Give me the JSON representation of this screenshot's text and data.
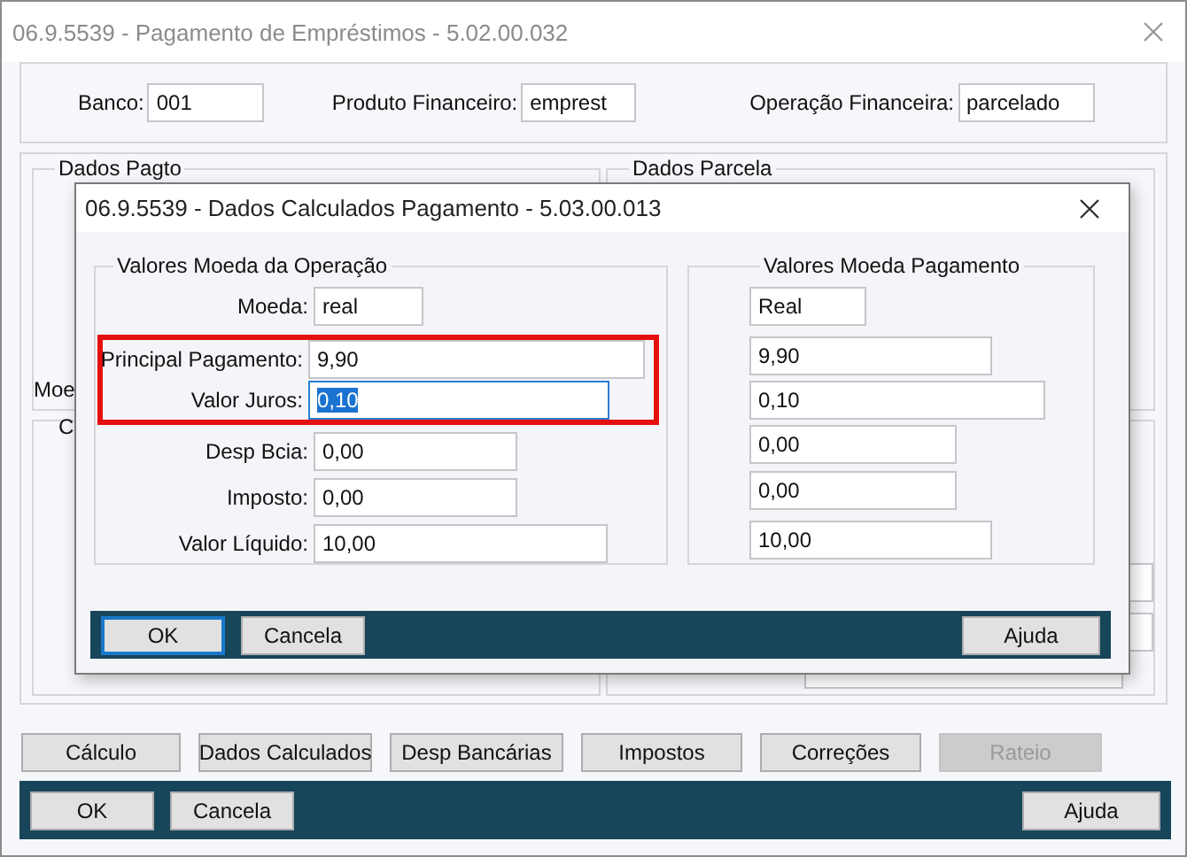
{
  "window": {
    "title": "06.9.5539 - Pagamento de Empréstimos - 5.02.00.032"
  },
  "header_fields": [
    {
      "label": "Banco:",
      "value": "001"
    },
    {
      "label": "Produto Financeiro:",
      "value": "emprest"
    },
    {
      "label": "Operação Financeira:",
      "value": "parcelado"
    }
  ],
  "groups": [
    {
      "title": "Dados Pagto",
      "partial_label": "Moe"
    },
    {
      "title": "Dados Parcela"
    }
  ],
  "lower_left": {
    "partial_label": "C"
  },
  "action_buttons": [
    {
      "label": "Cálculo",
      "disabled": false
    },
    {
      "label": "Dados Calculados",
      "disabled": false
    },
    {
      "label": "Desp Bancárias",
      "disabled": false
    },
    {
      "label": "Impostos",
      "disabled": false
    },
    {
      "label": "Correções",
      "disabled": false
    },
    {
      "label": "Rateio",
      "disabled": true
    }
  ],
  "footer_buttons": [
    {
      "label": "OK",
      "focused": false
    },
    {
      "label": "Cancela",
      "focused": false
    },
    {
      "label": "Ajuda",
      "focused": false
    }
  ],
  "dialog": {
    "title": "06.9.5539 - Dados Calculados Pagamento - 5.03.00.013",
    "left_group": {
      "title": "Valores Moeda da Operação",
      "fields": [
        {
          "label": "Moeda:",
          "value": "real",
          "highlighted": false,
          "focused": false
        },
        {
          "label": "Principal Pagamento:",
          "value": "9,90",
          "highlighted": true,
          "focused": false
        },
        {
          "label": "Valor Juros:",
          "value": "0,10",
          "highlighted": true,
          "focused": true
        },
        {
          "label": "Desp Bcia:",
          "value": "0,00",
          "highlighted": false,
          "focused": false
        },
        {
          "label": "Imposto:",
          "value": "0,00",
          "highlighted": false,
          "focused": false
        },
        {
          "label": "Valor Líquido:",
          "value": "10,00",
          "highlighted": false,
          "focused": false
        }
      ]
    },
    "right_group": {
      "title": "Valores Moeda Pagamento",
      "fields": [
        {
          "value": "Real"
        },
        {
          "value": "9,90"
        },
        {
          "value": "0,10"
        },
        {
          "value": "0,00"
        },
        {
          "value": "0,00"
        },
        {
          "value": "10,00"
        }
      ]
    },
    "buttons": [
      {
        "label": "OK",
        "focused": true
      },
      {
        "label": "Cancela",
        "focused": false
      },
      {
        "label": "Ajuda",
        "focused": false
      }
    ]
  }
}
